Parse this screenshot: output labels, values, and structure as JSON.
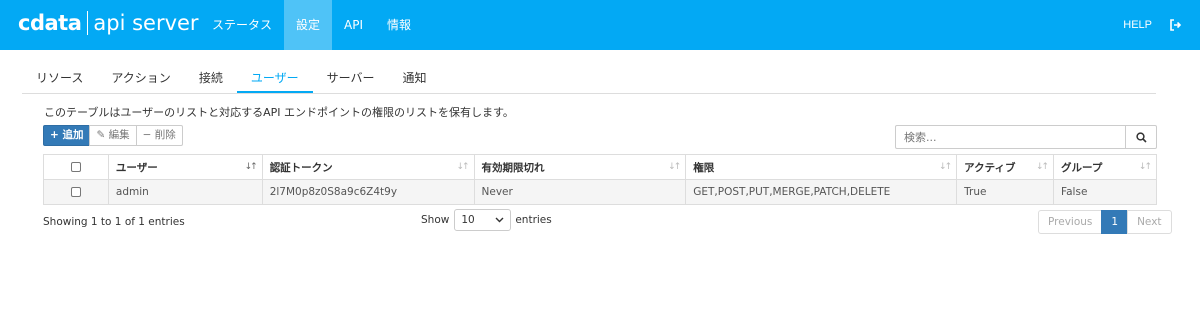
{
  "header": {
    "brand": "cdata",
    "product": "api server",
    "nav": [
      {
        "label": "ステータス",
        "active": false
      },
      {
        "label": "設定",
        "active": true
      },
      {
        "label": "API",
        "active": false
      },
      {
        "label": "情報",
        "active": false
      }
    ],
    "help": "HELP",
    "logout_icon": "logout-icon"
  },
  "tabs": [
    {
      "label": "リソース",
      "active": false
    },
    {
      "label": "アクション",
      "active": false
    },
    {
      "label": "接続",
      "active": false
    },
    {
      "label": "ユーザー",
      "active": true
    },
    {
      "label": "サーバー",
      "active": false
    },
    {
      "label": "通知",
      "active": false
    }
  ],
  "description": "このテーブルはユーザーのリストと対応するAPI エンドポイントの権限のリストを保有します。",
  "toolbar": {
    "add": "+ 追加",
    "edit": "編集",
    "delete": "削除"
  },
  "search": {
    "placeholder": "検索..."
  },
  "table": {
    "columns": [
      "ユーザー",
      "認証トークン",
      "有効期限切れ",
      "権限",
      "アクティブ",
      "グループ"
    ],
    "rows": [
      [
        "admin",
        "2l7M0p8z0S8a9c6Z4t9y",
        "Never",
        "GET,POST,PUT,MERGE,PATCH,DELETE",
        "True",
        "False"
      ]
    ]
  },
  "footer": {
    "info": "Showing 1 to 1 of 1 entries",
    "show_label": "Show",
    "page_size": "10",
    "entries_label": "entries",
    "previous": "Previous",
    "page": "1",
    "next": "Next"
  },
  "colors": {
    "header_bg": "#03a9f4",
    "accent": "#03a9f4",
    "primary": "#337ab7"
  }
}
